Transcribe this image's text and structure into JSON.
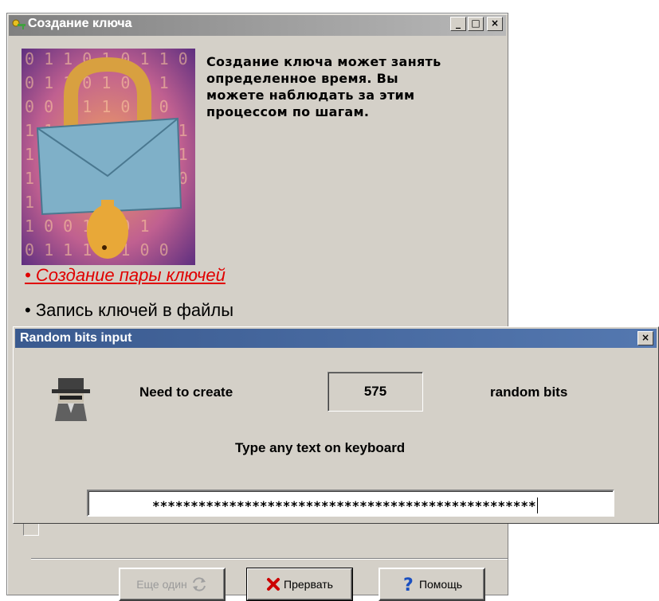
{
  "main_window": {
    "title": "Создание ключа",
    "controls": {
      "minimize": "_",
      "maximize": "□",
      "close": "×"
    },
    "info_text": "Создание ключа может занять определенное время. Вы можете наблюдать за этим процессом по шагам.",
    "picture": {
      "binary_text": [
        "0 1 1 0 1 0 1 1 0 0",
        "0 1 1 0 1 0 0 1",
        "0 0 1 1 1 0 1 0",
        "1 1 0 1 0 0 1 0 1",
        "1 1 0 0 0 1 0 1 1",
        "1 1 0 1 0 1 0 1 0",
        "1 1 0 0 0 1 1 0",
        "1 0 0 1 1 0 1",
        "0 1 1 1 0 1 0 0"
      ]
    },
    "steps": [
      {
        "label": "• Создание пары ключей",
        "state": "active",
        "color": "#e00000"
      },
      {
        "label": "• Запись ключей в файлы",
        "state": "pending"
      },
      {
        "label": "•"
      },
      {
        "label": "•"
      },
      {
        "label": "•"
      }
    ],
    "buttons": {
      "another": "Еще один",
      "abort": "Прервать",
      "help": "Помощь"
    }
  },
  "dialog": {
    "title": "Random bits input",
    "close": "×",
    "need_label": "Need to create",
    "count": "575",
    "bits_label": "random bits",
    "instruction": "Type any text on keyboard",
    "input_value": "**************************************************"
  },
  "colors": {
    "dialog_title_bar": "#3a5a8f",
    "window_face": "#d4d0c8",
    "active_step": "#e00000"
  }
}
